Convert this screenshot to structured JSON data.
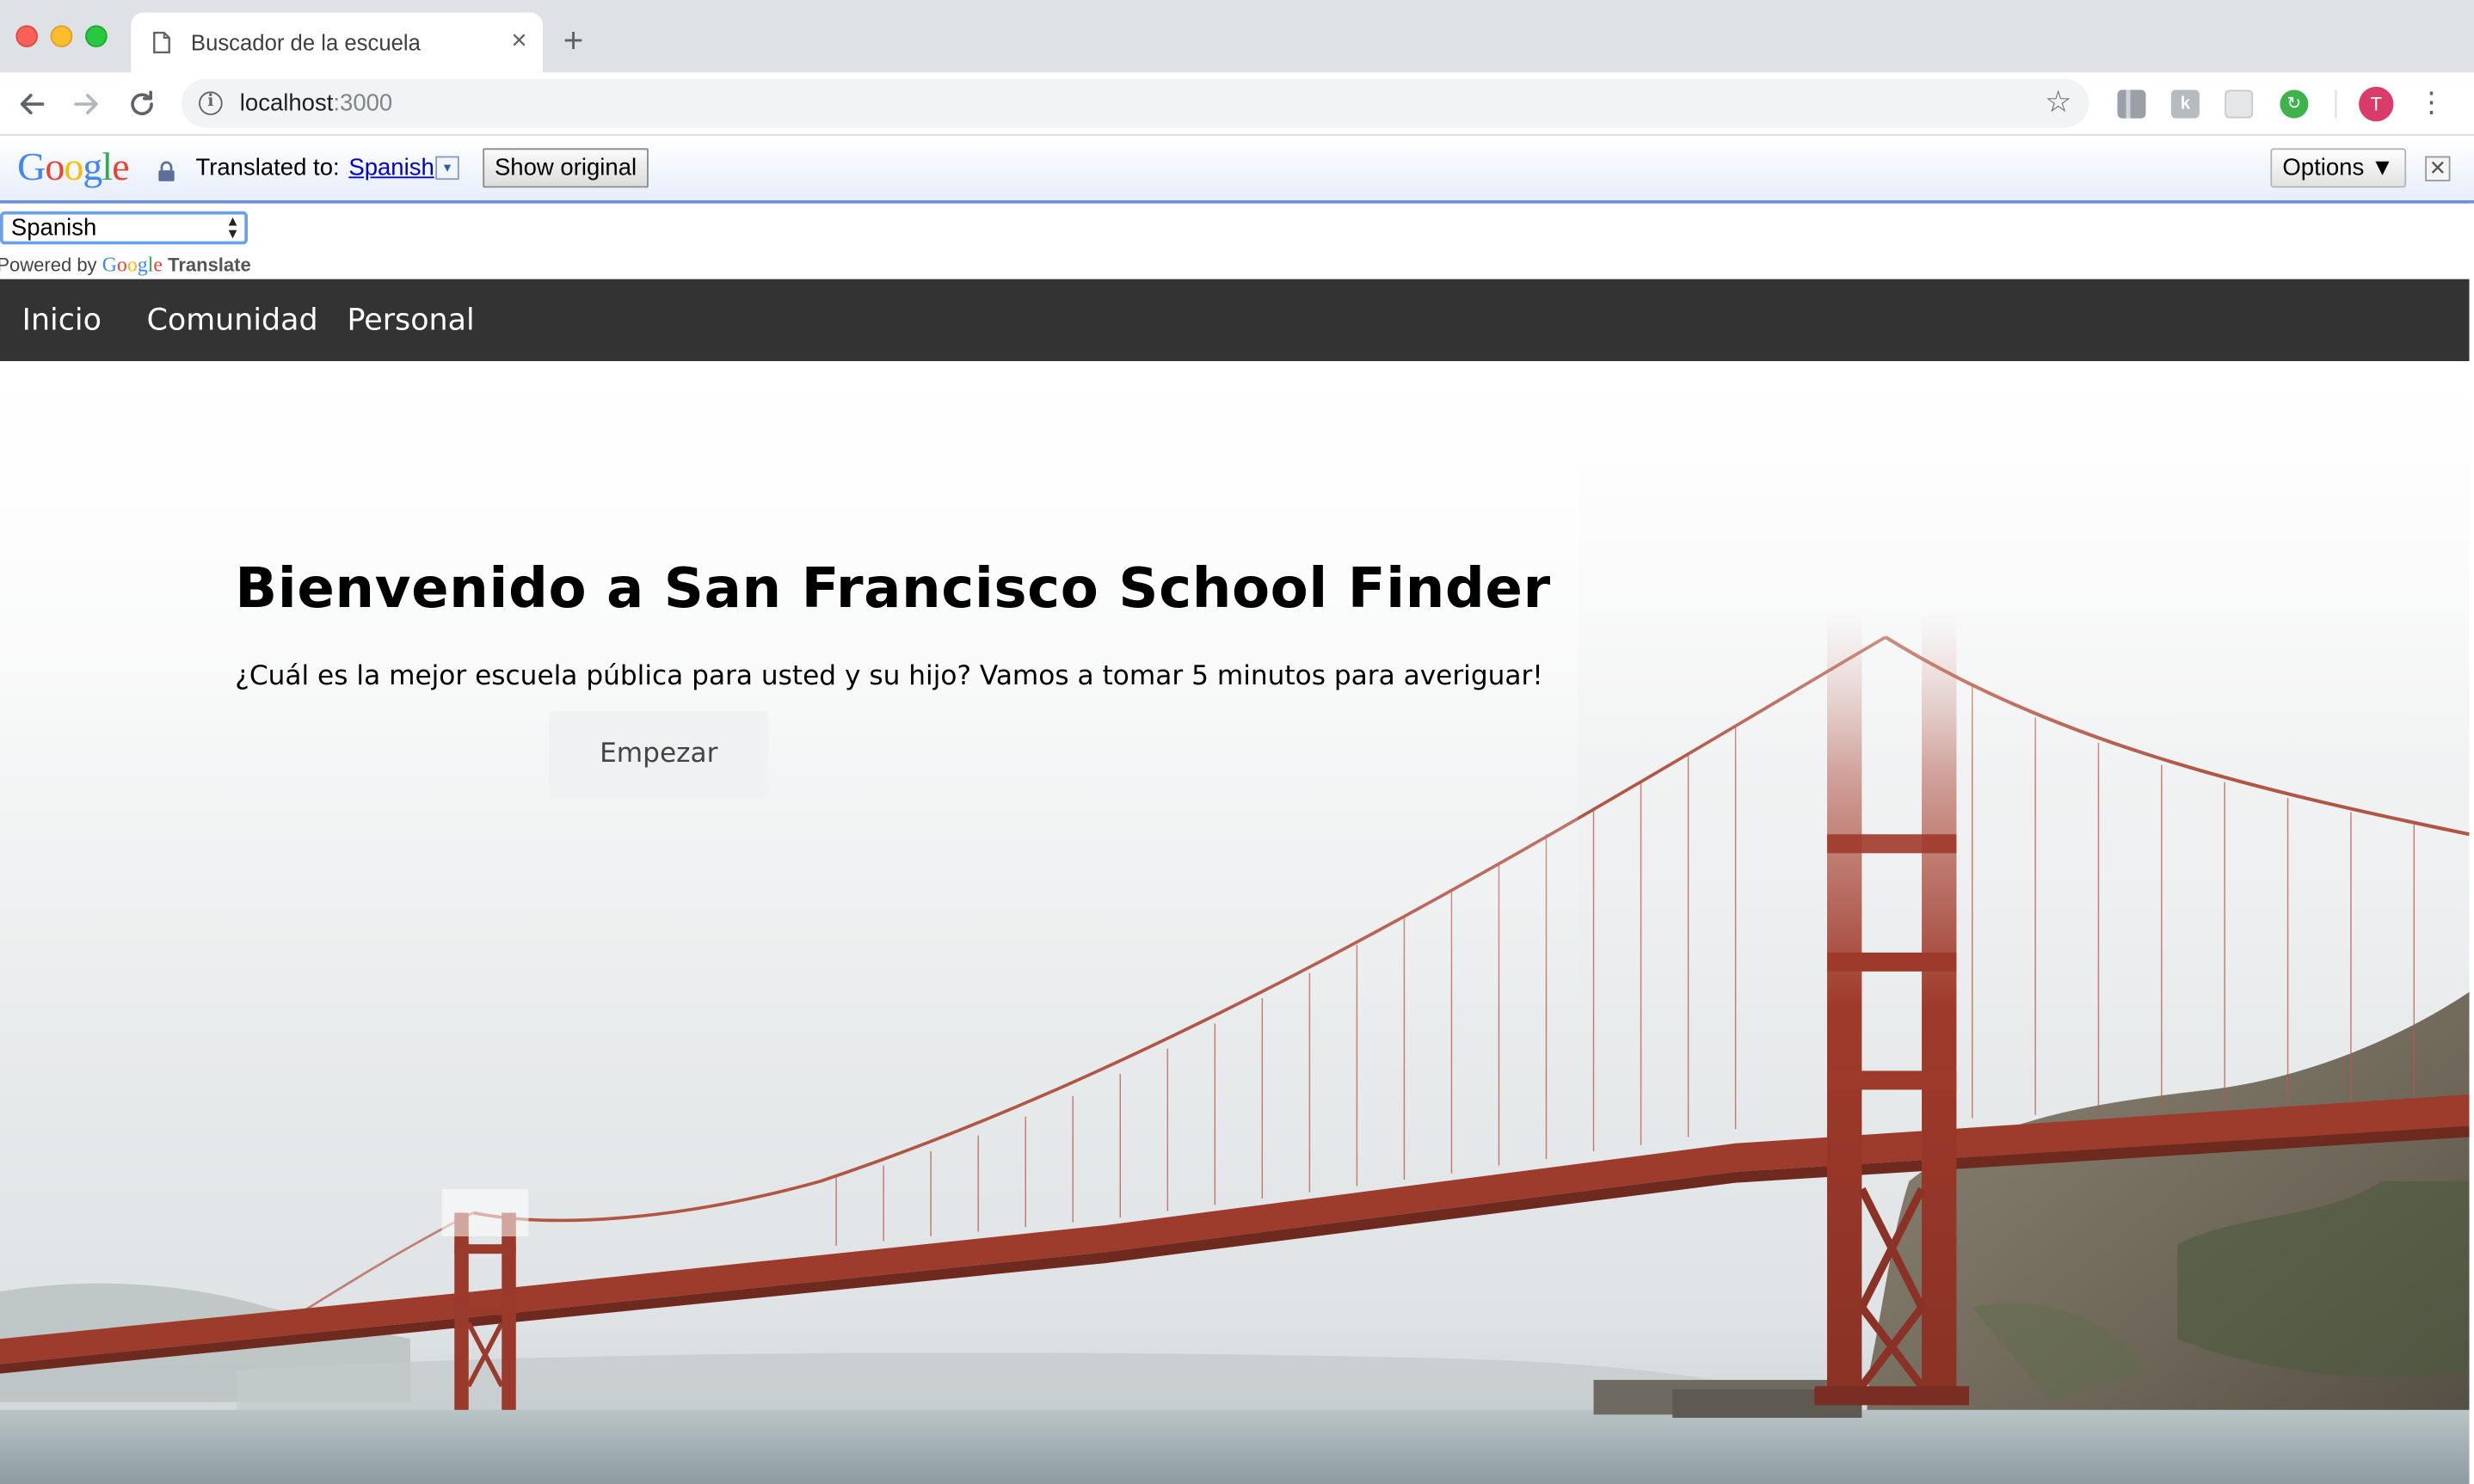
{
  "browser": {
    "tab_title": "Buscador de la escuela",
    "tab_close": "×",
    "new_tab": "+",
    "url_host": "localhost",
    "url_port": ":3000",
    "avatar_initial": "T",
    "extension_k": "k",
    "extension_g": "↻"
  },
  "translate_bar": {
    "translated_to_label": "Translated to:",
    "language": "Spanish",
    "dropdown_glyph": "▾",
    "show_original": "Show original",
    "options": "Options ▼",
    "close": "✕"
  },
  "page": {
    "language_select": "Spanish",
    "powered_by": "Powered by",
    "powered_translate": "Translate",
    "nav": {
      "inicio": "Inicio",
      "comunidad": "Comunidad",
      "personal": "Personal"
    },
    "hero": {
      "title": "Bienvenido a San Francisco School Finder",
      "subtitle": "¿Cuál es la mejor escuela pública para usted y su hijo? Vamos a tomar 5 minutos para averiguar!",
      "button": "Empezar"
    }
  },
  "colors": {
    "nav_background": "#333333",
    "bridge_red": "#a8402f",
    "translate_link": "#0000cc"
  }
}
